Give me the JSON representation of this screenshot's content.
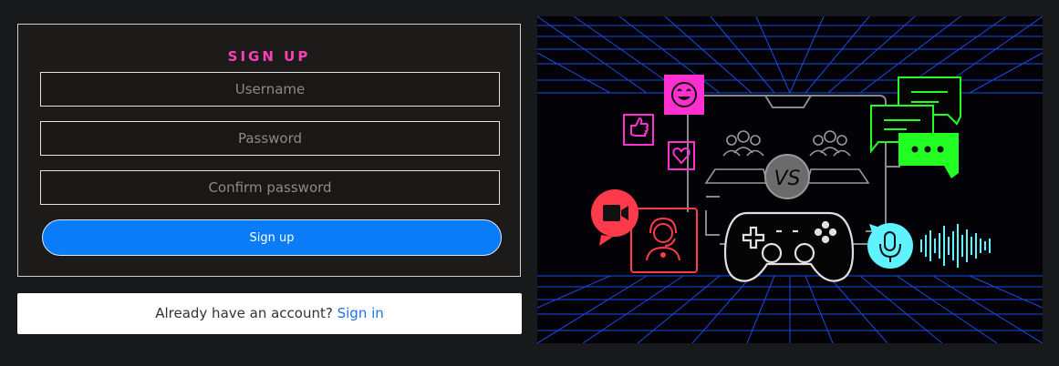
{
  "form": {
    "title": "SIGN UP",
    "username_placeholder": "Username",
    "password_placeholder": "Password",
    "confirm_placeholder": "Confirm password",
    "submit_label": "Sign up"
  },
  "signin": {
    "prompt": "Already have an account?",
    "link_label": "Sign in"
  },
  "illustration": {
    "vs_text": "VS",
    "icons": [
      "smile-icon",
      "thumbs-up-icon",
      "heart-icon",
      "video-call-icon",
      "headset-agent-icon",
      "audience-icon",
      "game-controller-icon",
      "chat-bubble-icon",
      "microphone-icon",
      "sound-wave-icon"
    ]
  },
  "colors": {
    "accent_pink": "#ff3fb8",
    "primary_blue": "#0a7cf8",
    "link_blue": "#1a73e8",
    "neon_green": "#22ff22",
    "neon_red": "#ff3a4a",
    "neon_cyan": "#5ef3ff",
    "grid_blue": "#1e52ff"
  }
}
